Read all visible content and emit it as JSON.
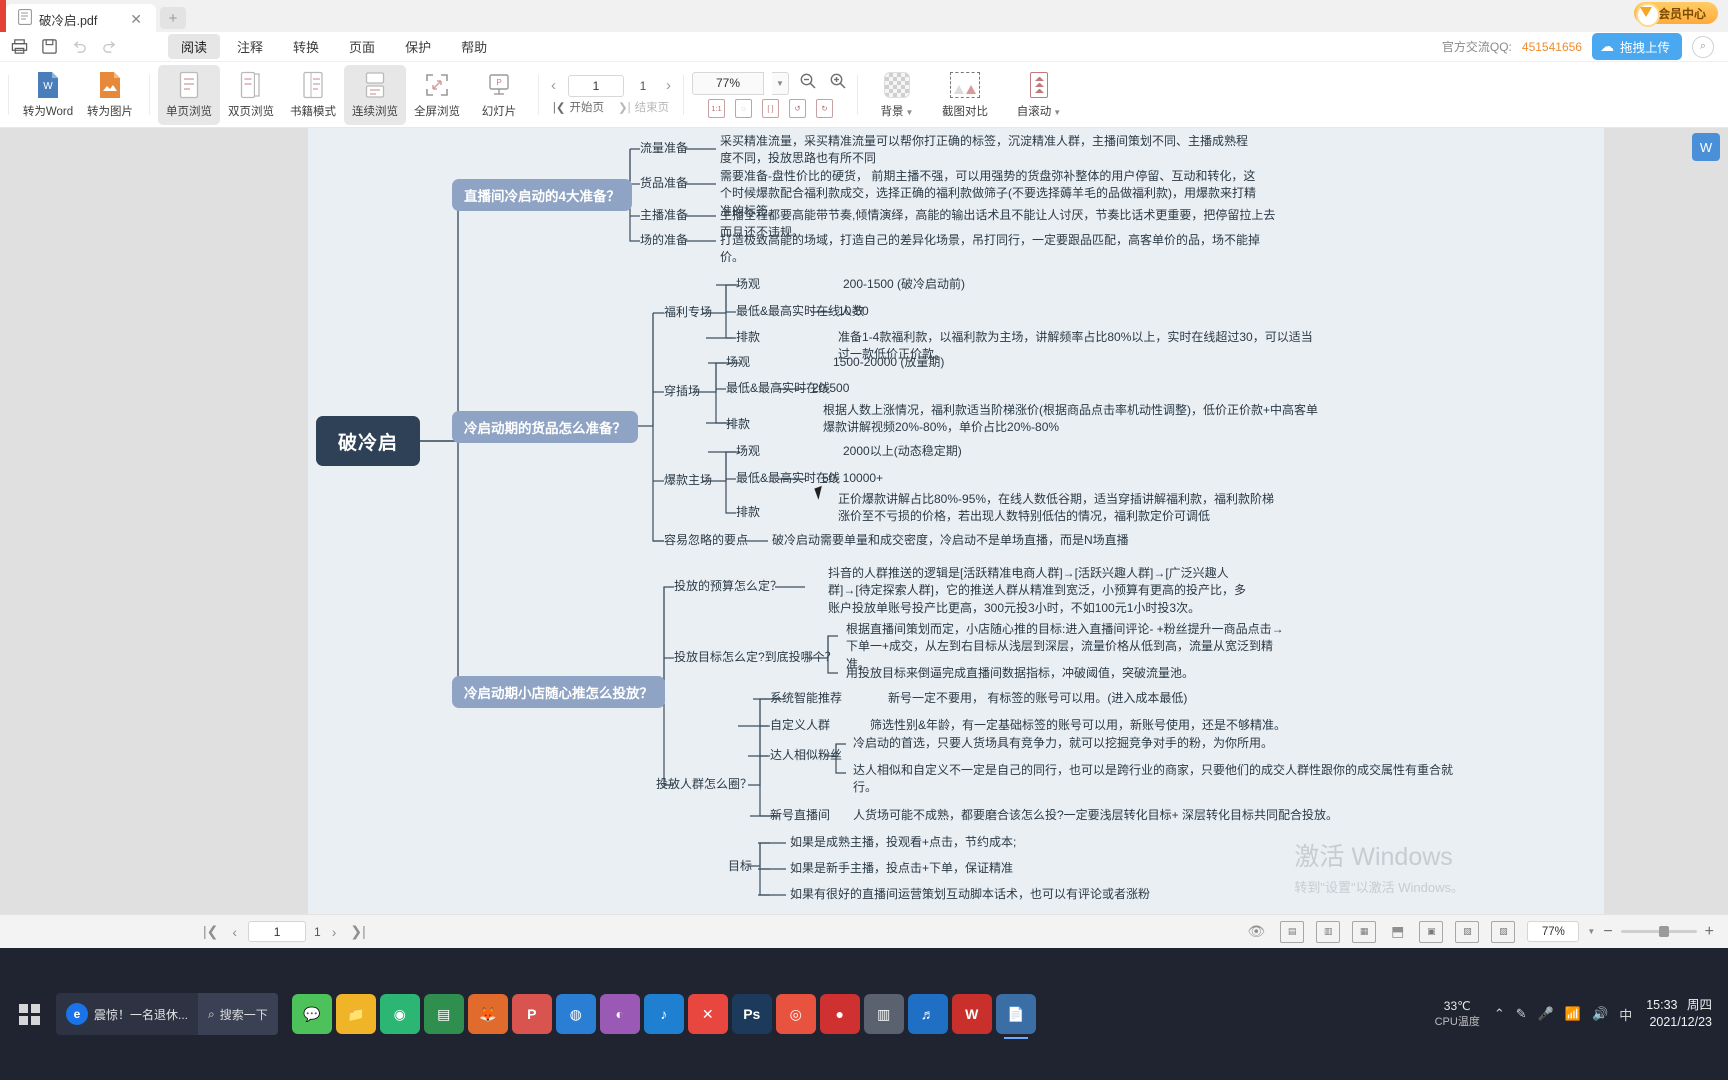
{
  "titlebar": {
    "tab_name": "破冷启.pdf",
    "tab_close": "✕",
    "new_tab": "+",
    "vip_label": "会员中心"
  },
  "menubar": {
    "items": [
      "阅读",
      "注释",
      "转换",
      "页面",
      "保护",
      "帮助"
    ],
    "active": "阅读",
    "qq_label": "官方交流QQ:",
    "qq_number": "451541656",
    "upload_label": "拖拽上传"
  },
  "ribbon": {
    "convert_word": "转为Word",
    "convert_image": "转为图片",
    "view_single": "单页浏览",
    "view_double": "双页浏览",
    "view_book": "书籍模式",
    "view_continuous": "连续浏览",
    "view_fullscreen": "全屏浏览",
    "view_slides": "幻灯片",
    "page_current": "1",
    "page_total": "1",
    "page_first": "开始页",
    "page_last": "结束页",
    "zoom_value": "77%",
    "background": "背景",
    "screenshot_compare": "截图对比",
    "autoscroll": "自滚动"
  },
  "statusbar": {
    "page_current": "1",
    "page_total": "1",
    "zoom_value": "77%"
  },
  "taskbar": {
    "news_badge": "e",
    "news_text": "震惊！一名退休...",
    "search_label": "搜索一下",
    "temperature": "33℃",
    "temp_label": "CPU温度",
    "time": "15:33",
    "weekday": "周四",
    "date": "2021/12/23"
  },
  "document": {
    "watermark_line1": "激活 Windows",
    "watermark_line2": "转到\"设置\"以激活 Windows。",
    "root": "破冷启",
    "branches": [
      {
        "title": "直播间冷启动的4大准备？",
        "children": [
          {
            "label": "流量准备",
            "detail": "采买精准流量，采买精准流量可以帮你打正确的标签，沉淀精准人群，主播间策划不同、主播成熟程度不同，投放思路也有所不同"
          },
          {
            "label": "货品准备",
            "detail": "需要准备-盘性价比的硬货， 前期主播不强，可以用强势的货盘弥补整体的用户停留、互动和转化，这个时候爆款配合福利款成交，选择正确的福利款做筛子(不要选择薅羊毛的品做福利款)，用爆款来打精准的标签。"
          },
          {
            "label": "主播准备",
            "detail": "主播全程都要高能带节奏,倾情演绎，高能的输出话术且不能让人讨厌，节奏比话术更重要，把停留拉上去而且还不违规。"
          },
          {
            "label": "场的准备",
            "detail": "打造极致高能的场域，打造自己的差异化场景，吊打同行，一定要跟品匹配，高客单价的品，场不能掉价。"
          }
        ]
      },
      {
        "title": "冷启动期的货品怎么准备？",
        "groups": [
          {
            "label": "福利专场",
            "rows": [
              {
                "k": "场观",
                "v": "200-1500 (破冷启动前)"
              },
              {
                "k": "最低&最高实时在线人数",
                "v": "10-50"
              },
              {
                "k": "排款",
                "v": "准备1-4款福利款，以福利款为主场，讲解频率占比80%以上，实时在线超过30，可以适当过一款低价正价款。"
              }
            ]
          },
          {
            "label": "穿插场",
            "rows": [
              {
                "k": "场观",
                "v": "1500-20000 (放量期)"
              },
              {
                "k": "最低&最高实时在线",
                "v": "20-500"
              },
              {
                "k": "排款",
                "v": "根据人数上涨情况，福利款适当阶梯涨价(根据商品点击率机动性调整)，低价正价款+中高客单爆款讲解视频20%-80%，单价占比20%-80%"
              }
            ]
          },
          {
            "label": "爆款主场",
            "rows": [
              {
                "k": "场观",
                "v": "2000以上(动态稳定期)"
              },
              {
                "k": "最低&最高实时在线",
                "v": "50- 10000+"
              },
              {
                "k": "排款",
                "v": "正价爆款讲解占比80%-95%，在线人数低谷期，适当穿插讲解福利款，福利款阶梯涨价至不亏损的价格，若出现人数特别低估的情况，福利款定价可调低"
              }
            ]
          }
        ],
        "extra": {
          "label": "容易忽略的要点",
          "detail": "破冷启动需要单量和成交密度，冷启动不是单场直播，而是N场直播"
        }
      },
      {
        "title": "冷启动期小店随心推怎么投放？",
        "children": [
          {
            "label": "投放的预算怎么定？",
            "detail": "抖音的人群推送的逻辑是[活跃精准电商人群]→[活跃兴趣人群]→[广泛兴趣人群]→[待定探索人群]，它的推送人群从精准到宽泛，小预算有更高的投产比，多账户投放单账号投产比更高，300元投3小时，不如100元1小时投3次。"
          },
          {
            "label": "投放目标怎么定?到底投哪个？",
            "details": [
              "根据直播间策划而定，小店随心推的目标:进入直播间评论- +粉丝提升一商品点击→ 下单一+成交，从左到右目标从浅层到深层，流量价格从低到高，流量从宽泛到精准。",
              "用投放目标来倒逼完成直播间数据指标，冲破阈值，突破流量池。"
            ]
          },
          {
            "label": "投放人群怎么圈？",
            "subrows": [
              {
                "k": "系统智能推荐",
                "v": "新号一定不要用， 有标签的账号可以用。(进入成本最低)"
              },
              {
                "k": "自定义人群",
                "v": "筛选性别&年龄，有一定基础标签的账号可以用，新账号使用，还是不够精准。"
              },
              {
                "k": "达人相似粉丝",
                "v": "冷启动的首选，只要人货场具有竞争力，就可以挖掘竞争对手的粉，为你所用。"
              },
              {
                "k": "",
                "v": "达人相似和自定义不一定是自己的同行，也可以是跨行业的商家，只要他们的成交人群性跟你的成交属性有重合就行。"
              },
              {
                "k": "新号直播间",
                "v": "人货场可能不成熟，都要磨合该怎么投?一定要浅层转化目标+ 深层转化目标共同配合投放。"
              }
            ]
          },
          {
            "label": "目标",
            "subrows": [
              {
                "k": "",
                "v": "如果是成熟主播，投观看+点击，节约成本;"
              },
              {
                "k": "",
                "v": "如果是新手主播，投点击+下单，保证精准"
              },
              {
                "k": "",
                "v": "如果有很好的直播间运营策划互动脚本话术，也可以有评论或者涨粉"
              }
            ]
          }
        ]
      }
    ]
  }
}
